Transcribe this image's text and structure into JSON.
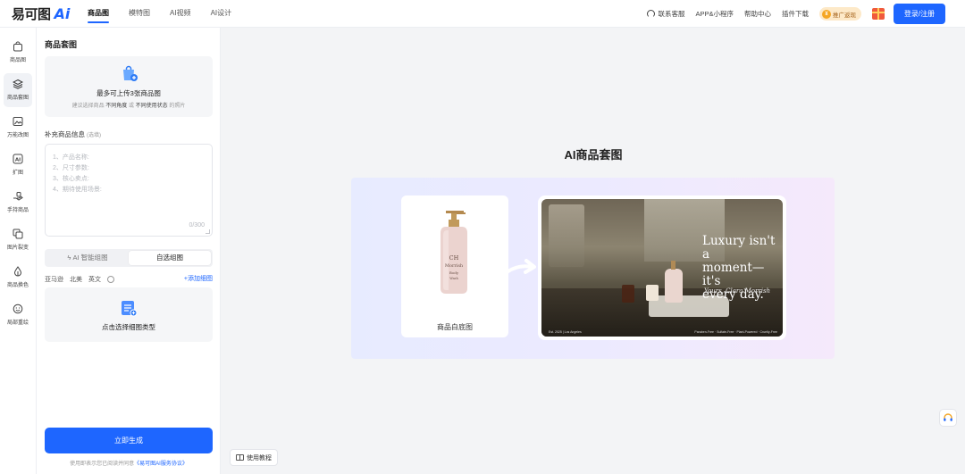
{
  "logo": {
    "text": "易可图",
    "ai": "Ai"
  },
  "nav": [
    {
      "label": "商品图",
      "active": true
    },
    {
      "label": "模特图",
      "active": false
    },
    {
      "label": "AI视频",
      "active": false
    },
    {
      "label": "AI设计",
      "active": false
    }
  ],
  "top_right": {
    "support": "联系客服",
    "app": "APP&小程序",
    "help": "帮助中心",
    "plugin": "插件下载",
    "promo": "推广返现",
    "login": "登录/注册"
  },
  "sidebar": [
    {
      "label": "商品图",
      "icon": "bag-icon",
      "active": false
    },
    {
      "label": "商品套图",
      "icon": "layers-icon",
      "active": true
    },
    {
      "label": "万能改图",
      "icon": "image-edit-icon",
      "active": false
    },
    {
      "label": "扩图",
      "icon": "ai-expand-icon",
      "active": false
    },
    {
      "label": "手持商品",
      "icon": "hand-icon",
      "active": false
    },
    {
      "label": "图片裂变",
      "icon": "image-split-icon",
      "active": false
    },
    {
      "label": "商品换色",
      "icon": "color-drop-icon",
      "active": false
    },
    {
      "label": "局部重绘",
      "icon": "smile-icon",
      "active": false
    }
  ],
  "panel": {
    "title": "商品套图",
    "upload": {
      "title": "最多可上传3张商品图",
      "tip_prefix": "建议选择商品",
      "tip_b1": "不同角度",
      "tip_mid": "或",
      "tip_b2": "不同使用状态",
      "tip_suffix": "的照片"
    },
    "info_label": "补充商品信息",
    "info_optional": "(选填)",
    "textarea_lines": [
      "1、产品名称:",
      "2、尺寸参数:",
      "3、核心卖点:",
      "4、期待使用场景:"
    ],
    "textarea_count": "0/300",
    "segments": [
      {
        "label": "AI 智能组图",
        "active": false
      },
      {
        "label": "自选组图",
        "active": true
      }
    ],
    "tags": [
      "亚马逊",
      "北美",
      "英文"
    ],
    "add_detail": "+添加细图",
    "detail_box": "点击选择细图类型",
    "generate": "立即生成",
    "agree_prefix": "使用即表示您已阅读并同意",
    "agree_link": "《易可图AI服务协议》"
  },
  "main": {
    "title": "AI商品套图",
    "white_label": "商品白底图",
    "bottle_brand": [
      "CH",
      "Morrish",
      "Body",
      "Wash"
    ],
    "photo_headline": [
      "Luxury isn't a",
      "moment—it's",
      "every day."
    ],
    "photo_sign": "Yours, Clara Morrish",
    "photo_foot_left": "Est. 2025 | Los Angeles",
    "photo_foot_right": "Paraben-Free · Sulfate-Free · Plant-Powered · Cruelty-Free",
    "tutorial": "使用教程"
  },
  "colors": {
    "accent": "#1e66ff",
    "promo_bg": "#fde9c8"
  }
}
